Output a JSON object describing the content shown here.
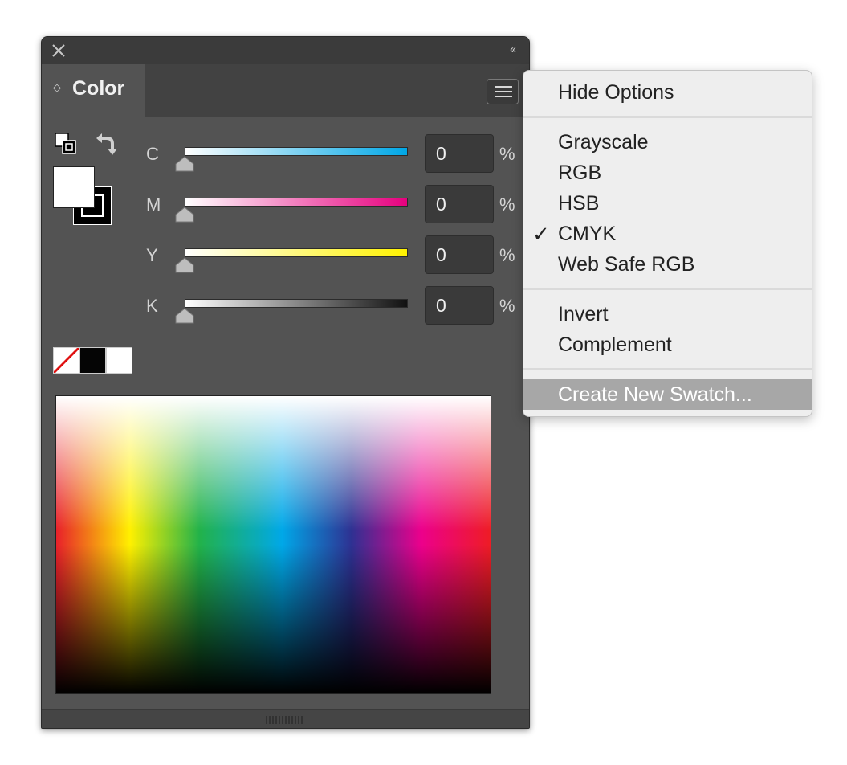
{
  "panel": {
    "tab_label": "Color",
    "collapse_glyph": "‹‹",
    "tab_arrows_glyph": "◇"
  },
  "channels": [
    {
      "label": "C",
      "value": "0",
      "unit": "%",
      "gradient_end": "#00a7e6"
    },
    {
      "label": "M",
      "value": "0",
      "unit": "%",
      "gradient_end": "#e6007e"
    },
    {
      "label": "Y",
      "value": "0",
      "unit": "%",
      "gradient_end": "#fff200"
    },
    {
      "label": "K",
      "value": "0",
      "unit": "%",
      "gradient_end": "#111111"
    }
  ],
  "quick_swatches": [
    "none",
    "black",
    "white"
  ],
  "menu": {
    "items": [
      {
        "label": "Hide Options",
        "checked": false,
        "highlighted": false
      },
      {
        "label": "Grayscale",
        "checked": false,
        "highlighted": false
      },
      {
        "label": "RGB",
        "checked": false,
        "highlighted": false
      },
      {
        "label": "HSB",
        "checked": false,
        "highlighted": false
      },
      {
        "label": "CMYK",
        "checked": true,
        "highlighted": false
      },
      {
        "label": "Web Safe RGB",
        "checked": false,
        "highlighted": false
      },
      {
        "label": "Invert",
        "checked": false,
        "highlighted": false
      },
      {
        "label": "Complement",
        "checked": false,
        "highlighted": false
      },
      {
        "label": "Create New Swatch...",
        "checked": false,
        "highlighted": true
      }
    ],
    "check_glyph": "✓"
  },
  "colors": {
    "panel_bg": "#535353",
    "menu_bg": "#eeeeee",
    "menu_highlight": "#a7a7a7"
  }
}
